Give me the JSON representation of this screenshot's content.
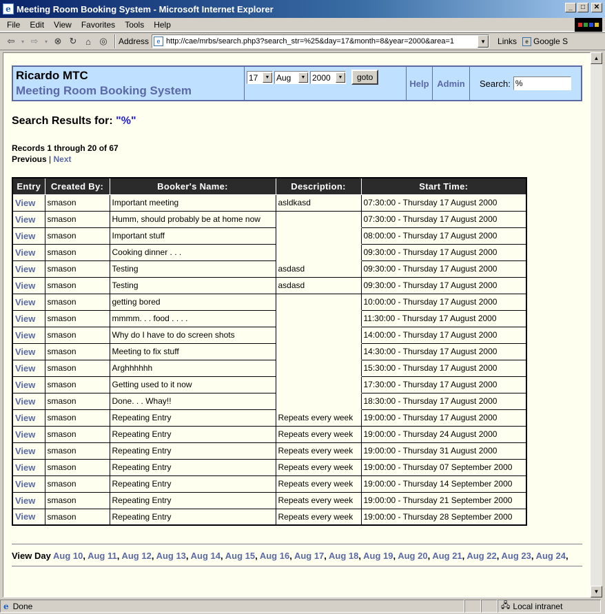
{
  "window": {
    "title": "Meeting Room Booking System - Microsoft Internet Explorer"
  },
  "menu": [
    "File",
    "Edit",
    "View",
    "Favorites",
    "Tools",
    "Help"
  ],
  "toolbar": {
    "address_label": "Address",
    "url": "http://cae/mrbs/search.php3?search_str=%25&day=17&month=8&year=2000&area=1",
    "links_label": "Links",
    "google_label": "Google S"
  },
  "banner": {
    "org_name": "Ricardo MTC",
    "system_name": "Meeting Room Booking System",
    "day": "17",
    "month": "Aug",
    "year": "2000",
    "goto_label": "goto",
    "help_label": "Help",
    "admin_label": "Admin",
    "search_label": "Search:",
    "search_value": "%"
  },
  "results": {
    "heading_prefix": "Search Results for: ",
    "query": "\"%\"",
    "records_text": "Records 1 through 20 of 67",
    "previous_label": "Previous",
    "pipe": "|",
    "next_label": "Next"
  },
  "table": {
    "headers": [
      "Entry",
      "Created By:",
      "Booker's Name:",
      "Description:",
      "Start Time:"
    ],
    "rows": [
      {
        "entry": "View",
        "created_by": "smason",
        "name": "Important meeting",
        "description": "asldkasd",
        "start": "07:30:00 - Thursday 17 August 2000"
      },
      {
        "entry": "View",
        "created_by": "smason",
        "name": "Humm, should probably be at home now",
        "description": "",
        "start": "07:30:00 - Thursday 17 August 2000"
      },
      {
        "entry": "View",
        "created_by": "smason",
        "name": "Important stuff",
        "description": "",
        "start": "08:00:00 - Thursday 17 August 2000"
      },
      {
        "entry": "View",
        "created_by": "smason",
        "name": "Cooking dinner . . .",
        "description": "",
        "start": "09:30:00 - Thursday 17 August 2000"
      },
      {
        "entry": "View",
        "created_by": "smason",
        "name": "Testing",
        "description": "asdasd",
        "start": "09:30:00 - Thursday 17 August 2000"
      },
      {
        "entry": "View",
        "created_by": "smason",
        "name": "Testing",
        "description": "asdasd",
        "start": "09:30:00 - Thursday 17 August 2000"
      },
      {
        "entry": "View",
        "created_by": "smason",
        "name": "getting bored",
        "description": "",
        "start": "10:00:00 - Thursday 17 August 2000"
      },
      {
        "entry": "View",
        "created_by": "smason",
        "name": "mmmm. . . food . . . .",
        "description": "",
        "start": "11:30:00 - Thursday 17 August 2000"
      },
      {
        "entry": "View",
        "created_by": "smason",
        "name": "Why do I have to do screen shots",
        "description": "",
        "start": "14:00:00 - Thursday 17 August 2000"
      },
      {
        "entry": "View",
        "created_by": "smason",
        "name": "Meeting to fix stuff",
        "description": "",
        "start": "14:30:00 - Thursday 17 August 2000"
      },
      {
        "entry": "View",
        "created_by": "smason",
        "name": "Arghhhhhh",
        "description": "",
        "start": "15:30:00 - Thursday 17 August 2000"
      },
      {
        "entry": "View",
        "created_by": "smason",
        "name": "Getting used to it now",
        "description": "",
        "start": "17:30:00 - Thursday 17 August 2000"
      },
      {
        "entry": "View",
        "created_by": "smason",
        "name": "Done. . . Whay!!",
        "description": "",
        "start": "18:30:00 - Thursday 17 August 2000"
      },
      {
        "entry": "View",
        "created_by": "smason",
        "name": "Repeating Entry",
        "description": "Repeats every week",
        "start": "19:00:00 - Thursday 17 August 2000"
      },
      {
        "entry": "View",
        "created_by": "smason",
        "name": "Repeating Entry",
        "description": "Repeats every week",
        "start": "19:00:00 - Thursday 24 August 2000"
      },
      {
        "entry": "View",
        "created_by": "smason",
        "name": "Repeating Entry",
        "description": "Repeats every week",
        "start": "19:00:00 - Thursday 31 August 2000"
      },
      {
        "entry": "View",
        "created_by": "smason",
        "name": "Repeating Entry",
        "description": "Repeats every week",
        "start": "19:00:00 - Thursday 07 September 2000"
      },
      {
        "entry": "View",
        "created_by": "smason",
        "name": "Repeating Entry",
        "description": "Repeats every week",
        "start": "19:00:00 - Thursday 14 September 2000"
      },
      {
        "entry": "View",
        "created_by": "smason",
        "name": "Repeating Entry",
        "description": "Repeats every week",
        "start": "19:00:00 - Thursday 21 September 2000"
      },
      {
        "entry": "View",
        "created_by": "smason",
        "name": "Repeating Entry",
        "description": "Repeats every week",
        "start": "19:00:00 - Thursday 28 September 2000"
      }
    ]
  },
  "view_day": {
    "label": "View Day",
    "days": [
      "Aug 10",
      "Aug 11",
      "Aug 12",
      "Aug 13",
      "Aug 14",
      "Aug 15",
      "Aug 16",
      "Aug 17",
      "Aug 18",
      "Aug 19",
      "Aug 20",
      "Aug 21",
      "Aug 22",
      "Aug 23",
      "Aug 24"
    ]
  },
  "status": {
    "text": "Done",
    "zone": "Local intranet"
  },
  "colors": {
    "link": "#5b69a6",
    "banner_bg": "#c0e0ff",
    "page_bg": "#fffff0",
    "header_bg": "#2b2b2b"
  },
  "icons": [
    "back-icon",
    "forward-icon",
    "stop-icon",
    "refresh-icon",
    "home-icon",
    "search-icon",
    "page-icon",
    "ie-icon",
    "intranet-icon"
  ]
}
